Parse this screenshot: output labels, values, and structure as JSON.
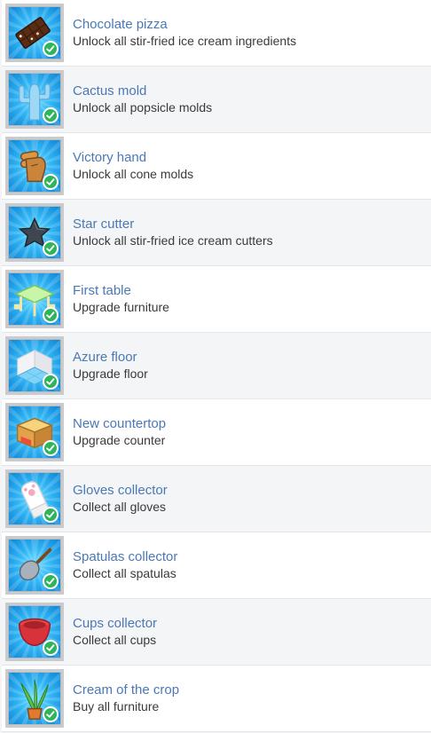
{
  "achievements": [
    {
      "title": "Chocolate pizza",
      "description": "Unlock all stir-fried ice cream ingredients",
      "icon": "chocolate-icon",
      "unlocked": true
    },
    {
      "title": "Cactus mold",
      "description": "Unlock all popsicle molds",
      "icon": "cactus-icon",
      "unlocked": true
    },
    {
      "title": "Victory hand",
      "description": "Unlock all cone molds",
      "icon": "victory-hand-icon",
      "unlocked": true
    },
    {
      "title": "Star cutter",
      "description": "Unlock all stir-fried ice cream cutters",
      "icon": "star-cutter-icon",
      "unlocked": true
    },
    {
      "title": "First table",
      "description": "Upgrade furniture",
      "icon": "table-icon",
      "unlocked": true
    },
    {
      "title": "Azure floor",
      "description": "Upgrade floor",
      "icon": "floor-icon",
      "unlocked": true
    },
    {
      "title": "New countertop",
      "description": "Upgrade counter",
      "icon": "countertop-icon",
      "unlocked": true
    },
    {
      "title": "Gloves collector",
      "description": "Collect all gloves",
      "icon": "glove-icon",
      "unlocked": true
    },
    {
      "title": "Spatulas collector",
      "description": "Collect all spatulas",
      "icon": "spatula-icon",
      "unlocked": true
    },
    {
      "title": "Cups collector",
      "description": "Collect all cups",
      "icon": "cup-icon",
      "unlocked": true
    },
    {
      "title": "Cream of the crop",
      "description": "Buy all furniture",
      "icon": "plant-icon",
      "unlocked": true
    }
  ],
  "colors": {
    "title": "#4a79b6",
    "description": "#3a3a3a",
    "icon_background": "#32b6f5",
    "check_badge": "#2fb45a"
  }
}
